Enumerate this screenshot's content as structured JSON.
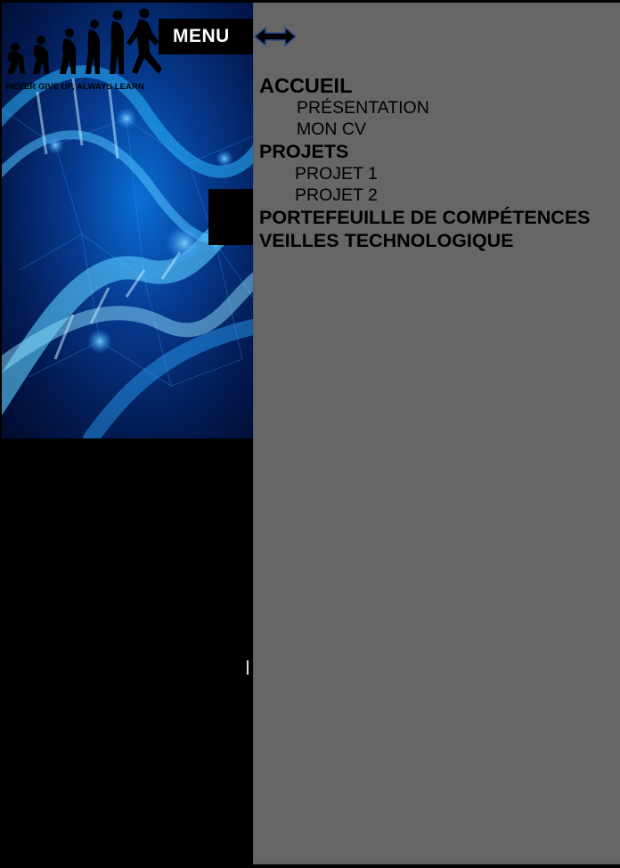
{
  "header": {
    "menu_label": "MENU",
    "tagline": "NEVER GIVE UP, ALWAYS LEARN"
  },
  "nav": {
    "accueil": "ACCUEIL",
    "presentation": "PRÉSENTATION",
    "mon_cv": "MON CV",
    "projets": "PROJETS",
    "projet_1": "PROJET 1",
    "projet_2": "PROJET 2",
    "portefeuille": "PORTEFEUILLE DE COMPÉTENCES",
    "veilles": "VEILLES TECHNOLOGIQUE"
  },
  "icons": {
    "toggle": "double-arrow-icon",
    "logo": "human-evolution-logo"
  },
  "colors": {
    "sidebar_bg": "#666666",
    "page_bg": "#000000",
    "hero_accent": "#1e90ff"
  }
}
